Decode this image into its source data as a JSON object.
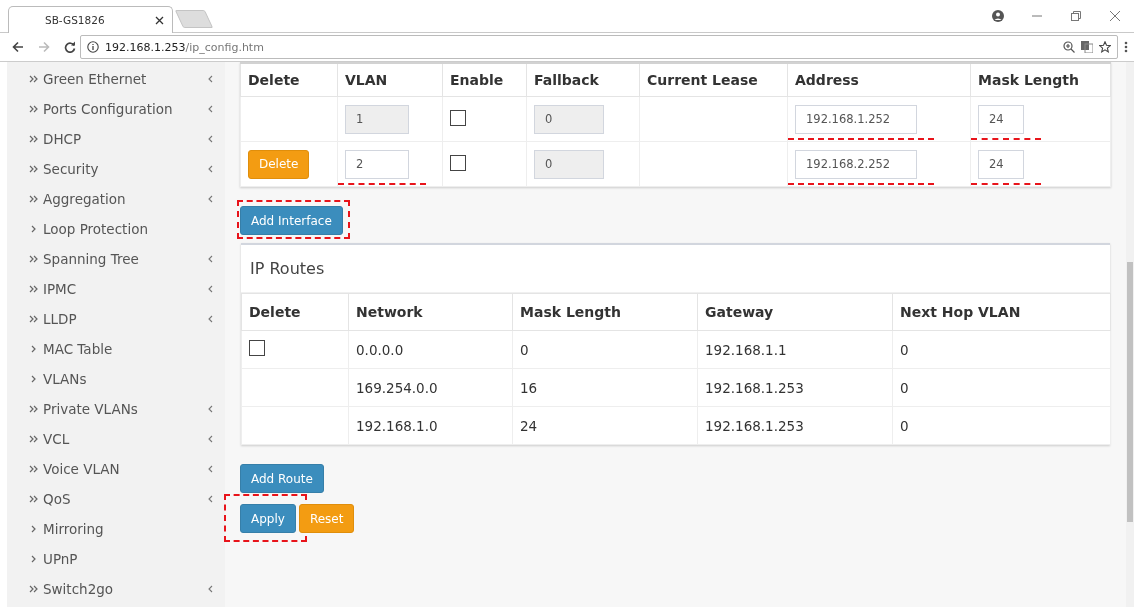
{
  "browser": {
    "tab_title": "SB-GS1826",
    "url_host": "192.168.1.253",
    "url_path": "/ip_config.htm"
  },
  "sidebar": {
    "items": [
      {
        "label": "Green Ethernet",
        "kind": "group"
      },
      {
        "label": "Ports Configuration",
        "kind": "group"
      },
      {
        "label": "DHCP",
        "kind": "group"
      },
      {
        "label": "Security",
        "kind": "group"
      },
      {
        "label": "Aggregation",
        "kind": "group"
      },
      {
        "label": "Loop Protection",
        "kind": "page"
      },
      {
        "label": "Spanning Tree",
        "kind": "group"
      },
      {
        "label": "IPMC",
        "kind": "group"
      },
      {
        "label": "LLDP",
        "kind": "group"
      },
      {
        "label": "MAC Table",
        "kind": "page"
      },
      {
        "label": "VLANs",
        "kind": "page"
      },
      {
        "label": "Private VLANs",
        "kind": "group"
      },
      {
        "label": "VCL",
        "kind": "group"
      },
      {
        "label": "Voice VLAN",
        "kind": "group"
      },
      {
        "label": "QoS",
        "kind": "group"
      },
      {
        "label": "Mirroring",
        "kind": "page"
      },
      {
        "label": "UPnP",
        "kind": "page"
      },
      {
        "label": "Switch2go",
        "kind": "group"
      }
    ]
  },
  "interfaces": {
    "columns": [
      "Delete",
      "VLAN",
      "Enable",
      "Fallback",
      "Current Lease",
      "Address",
      "Mask Length"
    ],
    "rows": [
      {
        "vlan": {
          "value": "1",
          "disabled": true,
          "underlined": false
        },
        "enable": {
          "checked": false
        },
        "fallback": {
          "value": "0",
          "disabled": true,
          "underlined": false
        },
        "address": {
          "value": "192.168.1.252",
          "disabled": false,
          "underlined": true
        },
        "mask_length": {
          "value": "24",
          "disabled": false,
          "underlined": true
        }
      },
      {
        "delete_button": {
          "label": "Delete",
          "kind": "warning",
          "boxed": false
        },
        "vlan": {
          "value": "2",
          "disabled": false,
          "underlined": true
        },
        "enable": {
          "checked": false
        },
        "fallback": {
          "value": "0",
          "disabled": true,
          "underlined": false
        },
        "address": {
          "value": "192.168.2.252",
          "disabled": false,
          "underlined": true
        },
        "mask_length": {
          "value": "24",
          "disabled": false,
          "underlined": true
        }
      }
    ],
    "add_button": {
      "label": "Add Interface",
      "kind": "primary",
      "boxed": true
    }
  },
  "routes": {
    "title": "IP Routes",
    "columns": [
      "Delete",
      "Network",
      "Mask Length",
      "Gateway",
      "Next Hop VLAN"
    ],
    "rows": [
      {
        "delete_checkbox": {
          "checked": false
        },
        "network": "0.0.0.0",
        "mask_length": "0",
        "gateway": "192.168.1.1",
        "next_hop_vlan": "0"
      },
      {
        "network": "169.254.0.0",
        "mask_length": "16",
        "gateway": "192.168.1.253",
        "next_hop_vlan": "0"
      },
      {
        "network": "192.168.1.0",
        "mask_length": "24",
        "gateway": "192.168.1.253",
        "next_hop_vlan": "0"
      }
    ],
    "add_button": {
      "label": "Add Route",
      "kind": "primary",
      "boxed": false
    }
  },
  "form_buttons": [
    {
      "label": "Apply",
      "kind": "primary",
      "boxed": true
    },
    {
      "label": "Reset",
      "kind": "warning",
      "boxed": false
    }
  ]
}
